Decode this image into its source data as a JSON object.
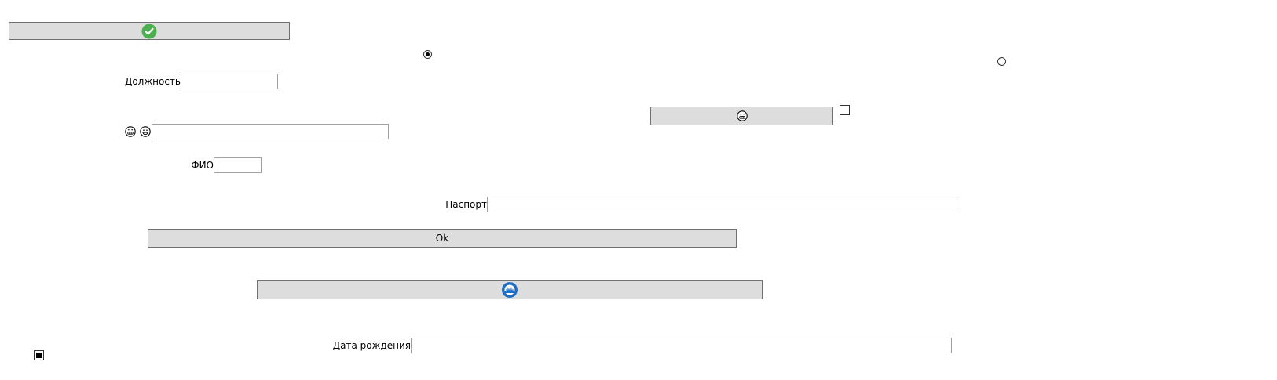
{
  "form": {
    "position_label": "Должность",
    "position_value": "",
    "emoji_field_value": "",
    "fio_label": "ФИО",
    "fio_value": "",
    "passport_label": "Паспорт",
    "passport_value": "",
    "ok_label": "Ok",
    "birthdate_label": "Дата рождения",
    "birthdate_value": ""
  },
  "controls": {
    "radio_1_checked": true,
    "radio_2_checked": false,
    "checkbox_1_checked": false,
    "checkbox_2_checked": true
  },
  "icons": {
    "top_button": "check-circle-icon",
    "emoji_button": "grimace-face-icon",
    "bottom_button": "blue-badge-icon",
    "field_prefix_1": "grimace-face-icon",
    "field_prefix_2": "grin-face-icon"
  },
  "colors": {
    "button_bg": "#dddddd",
    "check_green": "#4caf50",
    "badge_blue": "#1e6fc4"
  }
}
